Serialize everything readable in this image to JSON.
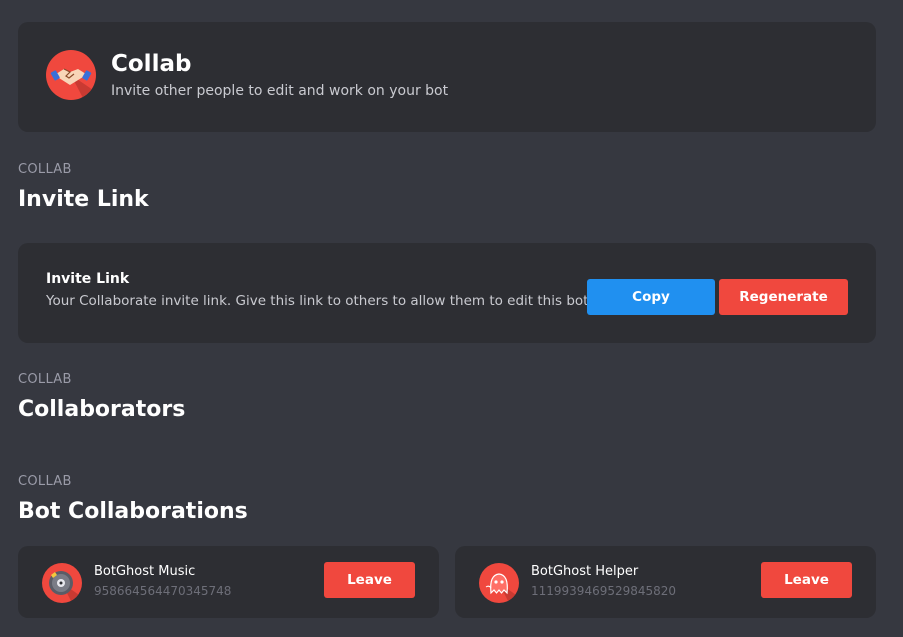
{
  "header": {
    "title": "Collab",
    "subtitle": "Invite other people to edit and work on your bot",
    "icon": "handshake-icon"
  },
  "invite_section": {
    "eyebrow": "COLLAB",
    "title": "Invite Link",
    "card": {
      "label": "Invite Link",
      "description": "Your Collaborate invite link. Give this link to others to allow them to edit this bot.",
      "copy_label": "Copy",
      "regenerate_label": "Regenerate"
    }
  },
  "collaborators_section": {
    "eyebrow": "COLLAB",
    "title": "Collaborators"
  },
  "bot_collabs_section": {
    "eyebrow": "COLLAB",
    "title": "Bot Collaborations",
    "items": [
      {
        "name": "BotGhost Music",
        "id": "958664564470345748",
        "leave_label": "Leave",
        "icon": "music-disc-icon"
      },
      {
        "name": "BotGhost Helper",
        "id": "1119939469529845820",
        "leave_label": "Leave",
        "icon": "ghost-icon"
      }
    ]
  },
  "colors": {
    "background": "#363840",
    "card": "#2d2e33",
    "accent_blue": "#2090f0",
    "accent_red": "#f0483e"
  }
}
